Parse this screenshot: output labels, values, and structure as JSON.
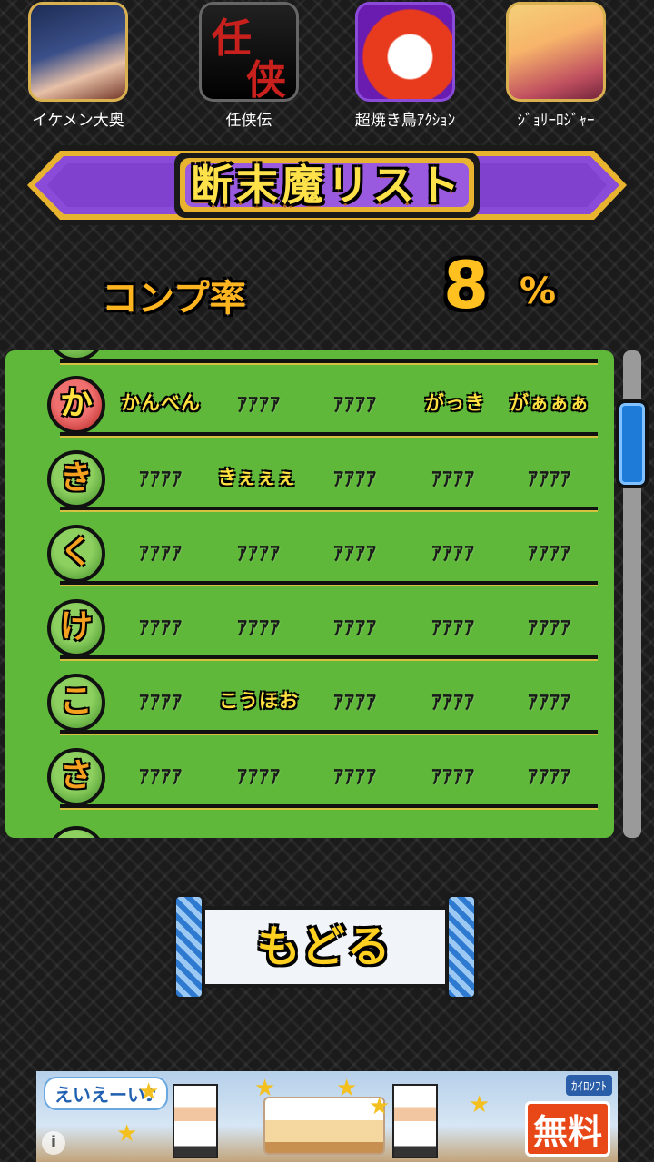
{
  "apps": [
    {
      "label": "イケメン大奥",
      "icon": "ikemen-ooku-app-icon"
    },
    {
      "label": "任侠伝",
      "icon": "ninkyouden-app-icon",
      "art_text": [
        "任",
        "侠"
      ]
    },
    {
      "label": "超焼き鳥ｱｸｼｮﾝ",
      "icon": "yakitori-action-app-icon"
    },
    {
      "label": "ｼﾞｮﾘｰﾛｼﾞｬｰ",
      "icon": "jolly-roger-app-icon"
    }
  ],
  "title": "断末魔リスト",
  "completion": {
    "label": "コンプ率",
    "value": "8",
    "unit": "%"
  },
  "rows": [
    {
      "kana": "か",
      "active": true,
      "items": [
        "かんべん",
        "ｱｱｱｱ",
        "ｱｱｱｱ",
        "がっき",
        "がぁぁぁ"
      ]
    },
    {
      "kana": "き",
      "active": false,
      "items": [
        "ｱｱｱｱ",
        "きぇぇぇ",
        "ｱｱｱｱ",
        "ｱｱｱｱ",
        "ｱｱｱｱ"
      ]
    },
    {
      "kana": "く",
      "active": false,
      "items": [
        "ｱｱｱｱ",
        "ｱｱｱｱ",
        "ｱｱｱｱ",
        "ｱｱｱｱ",
        "ｱｱｱｱ"
      ]
    },
    {
      "kana": "け",
      "active": false,
      "items": [
        "ｱｱｱｱ",
        "ｱｱｱｱ",
        "ｱｱｱｱ",
        "ｱｱｱｱ",
        "ｱｱｱｱ"
      ]
    },
    {
      "kana": "こ",
      "active": false,
      "items": [
        "ｱｱｱｱ",
        "こうほお",
        "ｱｱｱｱ",
        "ｱｱｱｱ",
        "ｱｱｱｱ"
      ]
    },
    {
      "kana": "さ",
      "active": false,
      "items": [
        "ｱｱｱｱ",
        "ｱｱｱｱ",
        "ｱｱｱｱ",
        "ｱｱｱｱ",
        "ｱｱｱｱ"
      ]
    }
  ],
  "back_button": {
    "label": "もどる"
  },
  "ad": {
    "bubble": "えいえーい♪",
    "brand": "ｶｲﾛｿﾌﾄ",
    "free_label": "無料",
    "info_icon": "i"
  },
  "colors": {
    "panel": "#5fb83a",
    "accent": "#ffc020",
    "scrollbar": "#1e7bd8",
    "banner": "#8a4bd8"
  }
}
